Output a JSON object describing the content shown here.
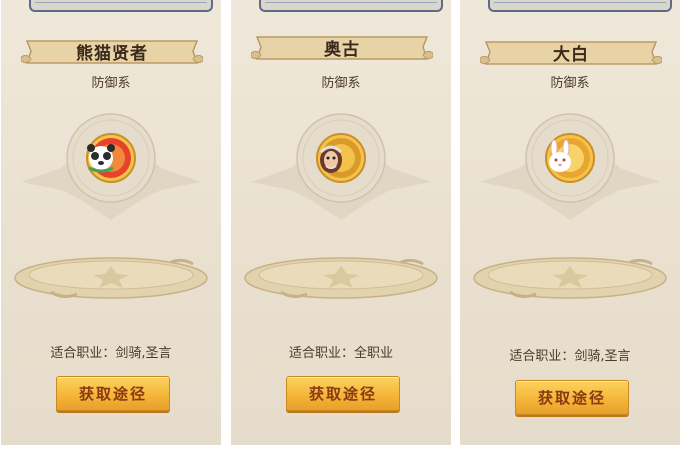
{
  "cards": [
    {
      "name": "熊猫贤者",
      "type": "防御系",
      "job": "适合职业：剑骑,圣言",
      "button": "获取途径",
      "avatar_icon": "panda-sage-icon",
      "avatar_colors": [
        "#e8422c",
        "#f08a3a"
      ]
    },
    {
      "name": "奥古",
      "type": "防御系",
      "job": "适合职业：全职业",
      "button": "获取途径",
      "avatar_icon": "augu-icon",
      "avatar_colors": [
        "#d99a2a",
        "#f2c24a"
      ]
    },
    {
      "name": "大白",
      "type": "防御系",
      "job": "适合职业：剑骑,圣言",
      "button": "获取途径",
      "avatar_icon": "white-rabbit-icon",
      "avatar_colors": [
        "#e8a530",
        "#f7d36a"
      ]
    }
  ],
  "colors": {
    "banner": "#e8d3a6",
    "banner_border": "#b99a66",
    "button": "#f4b63a",
    "button_text": "#8a3a12"
  }
}
